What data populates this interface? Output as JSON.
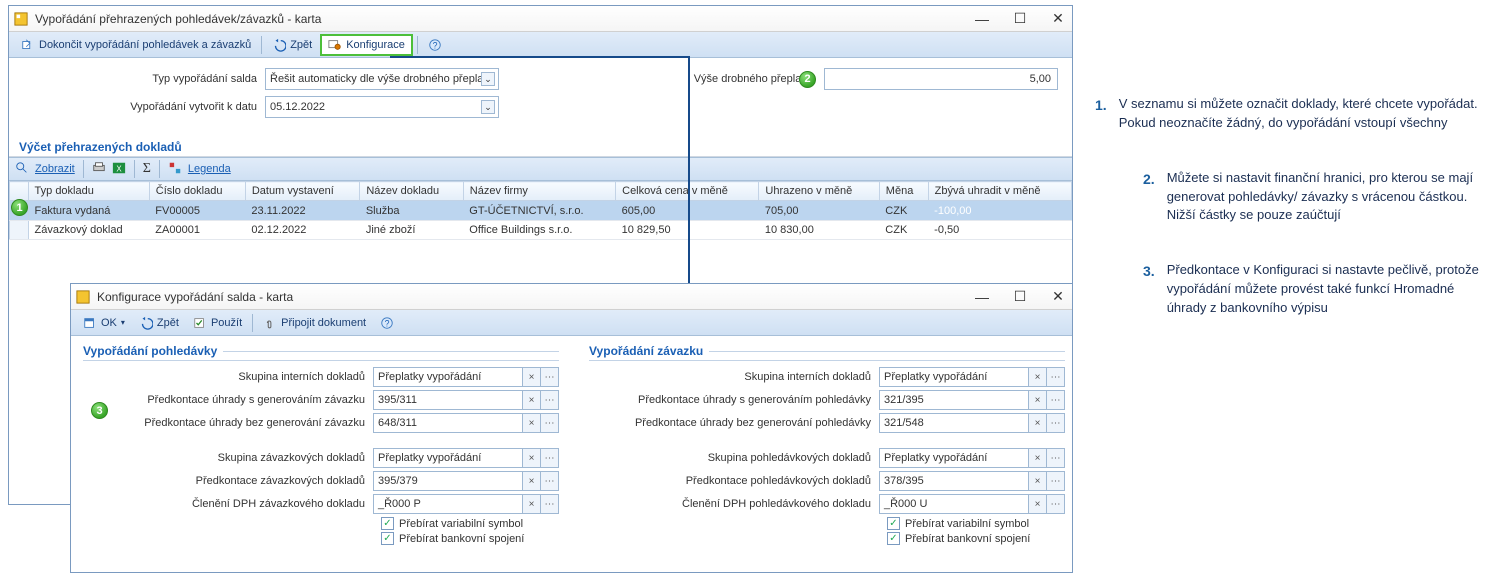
{
  "win1": {
    "title": "Vypořádání přehrazených pohledávek/závazků - karta",
    "toolbar": {
      "finish": "Dokončit vypořádání pohledávek a závazků",
      "back": "Zpět",
      "config": "Konfigurace"
    },
    "form": {
      "type_lbl": "Typ vypořádání salda",
      "type_val": "Řešit automaticky dle výše drobného přeplat",
      "date_lbl": "Vypořádání vytvořit k datu",
      "date_val": "05.12.2022",
      "amt_lbl": "Výše drobného přeplatku",
      "amt_val": "5,00"
    },
    "sect": "Výčet přehrazených dokladů",
    "gridbar": {
      "show": "Zobrazit",
      "legend": "Legenda"
    },
    "cols": {
      "c1": "Typ dokladu",
      "c2": "Číslo dokladu",
      "c3": "Datum vystavení",
      "c4": "Název dokladu",
      "c5": "Název firmy",
      "c6": "Celková cena v měně",
      "c7": "Uhrazeno v měně",
      "c8": "Měna",
      "c9": "Zbývá uhradit v měně"
    },
    "rows": [
      {
        "c1": "Faktura vydaná",
        "c2": "FV00005",
        "c3": "23.11.2022",
        "c4": "Služba",
        "c5": "GT-ÚČETNICTVÍ, s.r.o.",
        "c6": "605,00",
        "c7": "705,00",
        "c8": "CZK",
        "c9": "-100,00"
      },
      {
        "c1": "Závazkový doklad",
        "c2": "ZA00001",
        "c3": "02.12.2022",
        "c4": "Jiné zboží",
        "c5": "Office Buildings s.r.o.",
        "c6": "10 829,50",
        "c7": "10 830,00",
        "c8": "CZK",
        "c9": "-0,50"
      }
    ]
  },
  "win2": {
    "title": "Konfigurace vypořádání salda - karta",
    "toolbar": {
      "ok": "OK",
      "back": "Zpět",
      "apply": "Použít",
      "attach": "Připojit dokument"
    },
    "left": {
      "head": "Vypořádání pohledávky",
      "f1l": "Skupina interních dokladů",
      "f1v": "Přeplatky vypořádání",
      "f2l": "Předkontace úhrady s generováním závazku",
      "f2v": "395/311",
      "f3l": "Předkontace úhrady bez generování závazku",
      "f3v": "648/311",
      "f4l": "Skupina závazkových dokladů",
      "f4v": "Přeplatky vypořádání",
      "f5l": "Předkontace závazkových dokladů",
      "f5v": "395/379",
      "f6l": "Členění DPH závazkového dokladu",
      "f6v": "_Ř000 P",
      "chk1": "Přebírat variabilní symbol",
      "chk2": "Přebírat bankovní spojení"
    },
    "right": {
      "head": "Vypořádání závazku",
      "f1l": "Skupina interních dokladů",
      "f1v": "Přeplatky vypořádání",
      "f2l": "Předkontace úhrady s generováním pohledávky",
      "f2v": "321/395",
      "f3l": "Předkontace úhrady bez generování pohledávky",
      "f3v": "321/548",
      "f4l": "Skupina pohledávkových dokladů",
      "f4v": "Přeplatky vypořádání",
      "f5l": "Předkontace pohledávkových dokladů",
      "f5v": "378/395",
      "f6l": "Členění DPH pohledávkového dokladu",
      "f6v": "_Ř000 U",
      "chk1": "Přebírat variabilní symbol",
      "chk2": "Přebírat bankovní spojení"
    }
  },
  "notes": {
    "n1": "V seznamu si můžete označit doklady, které chcete vypořádat. Pokud neoznačíte žádný, do vypořádání vstoupí všechny",
    "n2": "Můžete si nastavit finanční hranici, pro kterou se mají generovat pohledávky/ závazky s vrácenou částkou. Nižší částky se pouze zaúčtují",
    "n3": "Předkontace v Konfiguraci si nastavte pečlivě, protože vypořádání můžete provést také funkcí Hromadné úhrady z bankovního výpisu"
  },
  "markers": {
    "m1": "1",
    "m2": "2",
    "m3": "3"
  }
}
